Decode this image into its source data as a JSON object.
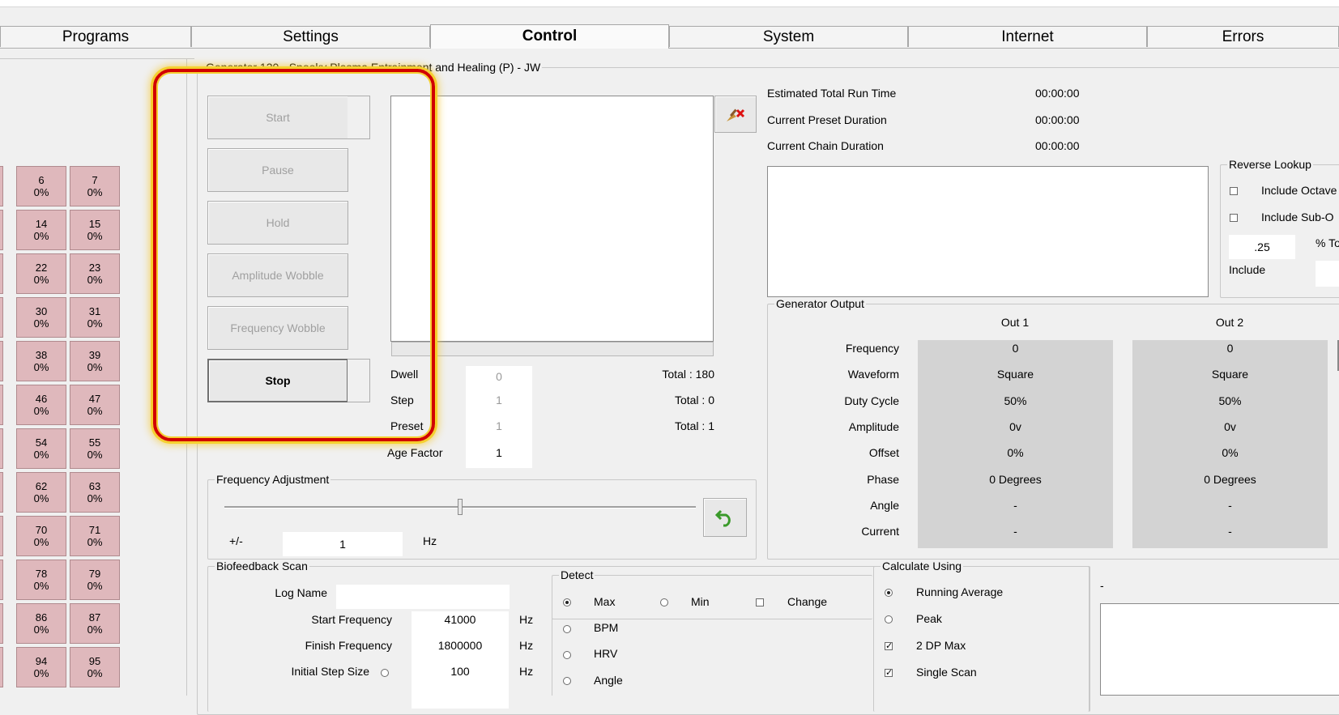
{
  "tabs": [
    "Programs",
    "Settings",
    "Control",
    "System",
    "Internet",
    "Errors"
  ],
  "program_title": "Generator 120 - Spooky Plasma Entrainment and Healing (P) - JW",
  "controls": {
    "start": "Start",
    "pause": "Pause",
    "hold": "Hold",
    "amplitude_wobble": "Amplitude Wobble",
    "frequency_wobble": "Frequency Wobble",
    "stop": "Stop"
  },
  "grid": [
    {
      "left": "6",
      "left_pct": "0%",
      "right": "7",
      "right_pct": "0%"
    },
    {
      "left": "14",
      "left_pct": "0%",
      "right": "15",
      "right_pct": "0%"
    },
    {
      "left": "22",
      "left_pct": "0%",
      "right": "23",
      "right_pct": "0%"
    },
    {
      "left": "30",
      "left_pct": "0%",
      "right": "31",
      "right_pct": "0%"
    },
    {
      "left": "38",
      "left_pct": "0%",
      "right": "39",
      "right_pct": "0%"
    },
    {
      "left": "46",
      "left_pct": "0%",
      "right": "47",
      "right_pct": "0%"
    },
    {
      "left": "54",
      "left_pct": "0%",
      "right": "55",
      "right_pct": "0%"
    },
    {
      "left": "62",
      "left_pct": "0%",
      "right": "63",
      "right_pct": "0%"
    },
    {
      "left": "70",
      "left_pct": "0%",
      "right": "71",
      "right_pct": "0%"
    },
    {
      "left": "78",
      "left_pct": "0%",
      "right": "79",
      "right_pct": "0%"
    },
    {
      "left": "86",
      "left_pct": "0%",
      "right": "87",
      "right_pct": "0%"
    },
    {
      "left": "94",
      "left_pct": "0%",
      "right": "95",
      "right_pct": "0%"
    }
  ],
  "progress": {
    "dwell_label": "Dwell",
    "dwell_value": "0",
    "dwell_total": "Total : 180",
    "step_label": "Step",
    "step_value": "1",
    "step_total": "Total : 0",
    "preset_label": "Preset",
    "preset_value": "1",
    "preset_total": "Total : 1",
    "age_label": "Age Factor",
    "age_value": "1"
  },
  "runtime": {
    "total_label": "Estimated Total Run Time",
    "total_value": "00:00:00",
    "preset_label": "Current Preset Duration",
    "preset_value": "00:00:00",
    "chain_label": "Current Chain Duration",
    "chain_value": "00:00:00"
  },
  "reverse_lookup": {
    "title": "Reverse Lookup",
    "include_octave": "Include Octave",
    "include_sub": "Include Sub-O",
    "tolerance_value": ".25",
    "tolerance_label": "% To",
    "include_label": "Include"
  },
  "generator_output": {
    "title": "Generator Output",
    "out1": "Out 1",
    "out2": "Out 2",
    "rows": [
      {
        "label": "Frequency",
        "out1": "0",
        "out2": "0"
      },
      {
        "label": "Waveform",
        "out1": "Square",
        "out2": "Square"
      },
      {
        "label": "Duty Cycle",
        "out1": "50%",
        "out2": "50%"
      },
      {
        "label": "Amplitude",
        "out1": "0v",
        "out2": "0v"
      },
      {
        "label": "Offset",
        "out1": "0%",
        "out2": "0%"
      },
      {
        "label": "Phase",
        "out1": "0 Degrees",
        "out2": "0 Degrees"
      },
      {
        "label": "Angle",
        "out1": "-",
        "out2": "-"
      },
      {
        "label": "Current",
        "out1": "-",
        "out2": "-"
      }
    ]
  },
  "freq_adjust": {
    "title": "Frequency Adjustment",
    "pm_label": "+/-",
    "value": "1",
    "unit": "Hz",
    "slider_level": 0.5
  },
  "biofeedback": {
    "title": "Biofeedback Scan",
    "log_name_label": "Log Name",
    "log_name_value": "",
    "start_label": "Start Frequency",
    "start_value": "41000",
    "start_unit": "Hz",
    "finish_label": "Finish Frequency",
    "finish_value": "1800000",
    "finish_unit": "Hz",
    "step_label": "Initial Step Size",
    "step_value": "100",
    "step_unit": "Hz"
  },
  "detect": {
    "title": "Detect",
    "max": "Max",
    "min": "Min",
    "change": "Change",
    "bpm": "BPM",
    "hrv": "HRV",
    "angle": "Angle"
  },
  "calculate": {
    "title": "Calculate Using",
    "running_average": "Running Average",
    "peak": "Peak",
    "dp_max": "2 DP Max",
    "single_scan": "Single Scan"
  },
  "side_dash": "-"
}
